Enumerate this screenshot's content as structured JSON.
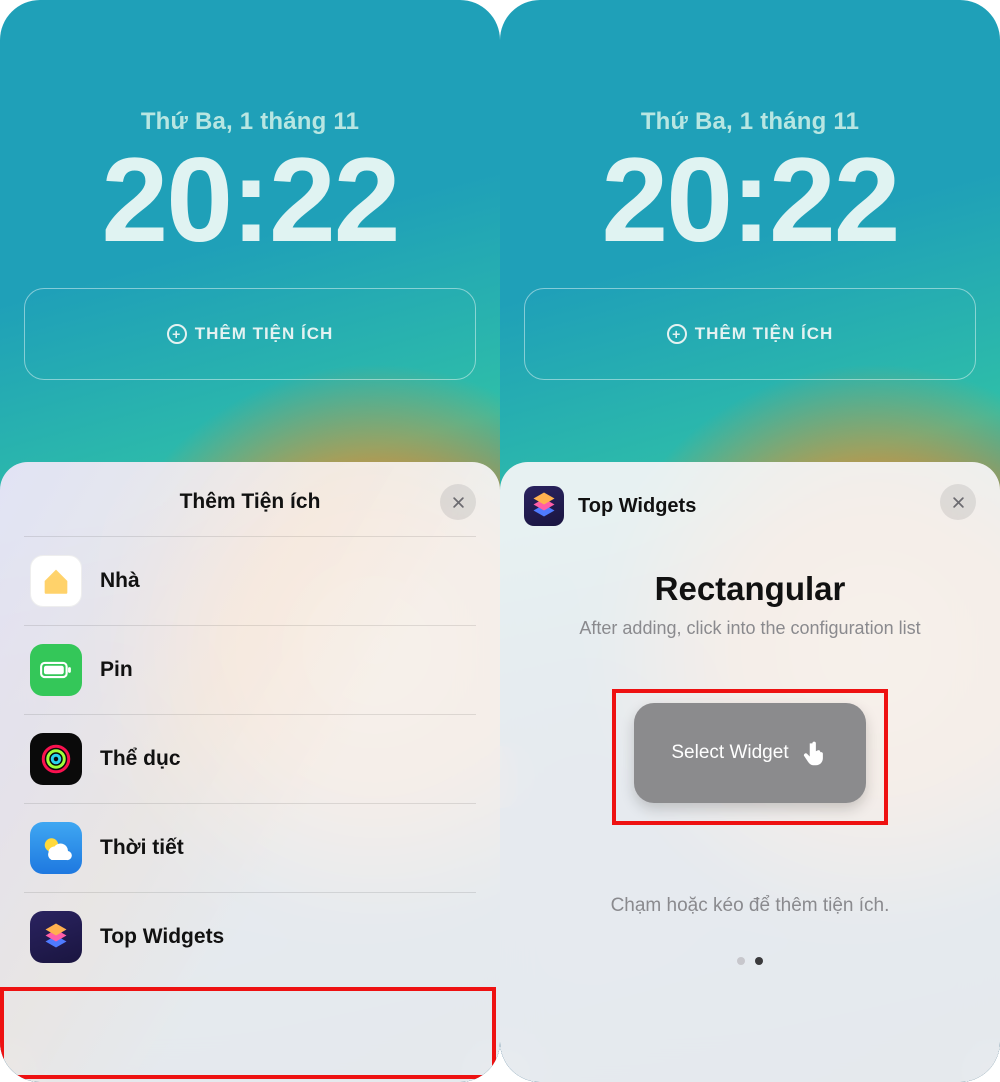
{
  "lock": {
    "date": "Thứ Ba, 1 tháng 11",
    "time": "20:22",
    "add_widget_label": "THÊM TIỆN ÍCH"
  },
  "left_sheet": {
    "title": "Thêm Tiện ích",
    "items": [
      {
        "label": "Nhà",
        "icon": "home-icon"
      },
      {
        "label": "Pin",
        "icon": "battery-icon"
      },
      {
        "label": "Thể dục",
        "icon": "fitness-icon"
      },
      {
        "label": "Thời tiết",
        "icon": "weather-icon"
      },
      {
        "label": "Top Widgets",
        "icon": "top-widgets-icon"
      }
    ]
  },
  "right_sheet": {
    "app_name": "Top Widgets",
    "title": "Rectangular",
    "subtitle": "After adding, click into the configuration list",
    "preview_label": "Select Widget",
    "hint": "Chạm hoặc kéo để thêm tiện ích.",
    "page_index": 1,
    "page_count": 2
  }
}
